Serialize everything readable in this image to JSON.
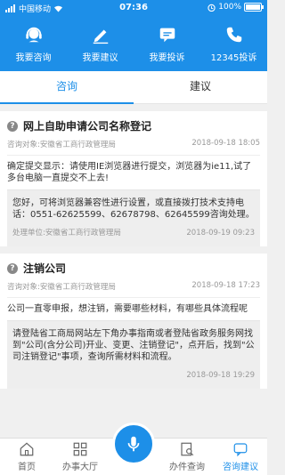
{
  "status": {
    "carrier": "中国移动",
    "time": "07:36",
    "battery": "100%"
  },
  "header": {
    "items": [
      {
        "label": "我要咨询",
        "icon": "headset-icon"
      },
      {
        "label": "我要建议",
        "icon": "pencil-note-icon"
      },
      {
        "label": "我要投诉",
        "icon": "chat-bubble-icon"
      },
      {
        "label": "12345投诉",
        "icon": "phone-icon"
      }
    ]
  },
  "tabs": [
    {
      "label": "咨询",
      "active": true
    },
    {
      "label": "建议",
      "active": false
    }
  ],
  "posts": [
    {
      "title": "网上自助申请公司名称登记",
      "target": "咨询对象:安徽省工商行政管理局",
      "date": "2018-09-18 18:05",
      "body": "确定提交显示：请使用IE浏览器进行提交，浏览器为ie11,试了多台电脑一直提交不上去!",
      "reply": "您好，可将浏览器兼容性进行设置，或直接拨打技术支持电话：0551-62625599、62678798、62645599咨询处理。",
      "reply_unit": "处理单位:安徽省工商行政管理局",
      "reply_date": "2018-09-19 09:23"
    },
    {
      "title": "注销公司",
      "target": "咨询对象:安徽省工商行政管理局",
      "date": "2018-09-18 17:23",
      "body": "公司一直零申报，想注销，需要哪些材料，有哪些具体流程呢",
      "reply": "请登陆省工商局网站左下角办事指南或者登陆省政务服务网找到\"公司(含分公司)开业、变更、注销登记\"，点开后，找到\"公司注销登记\"事项，查询所需材料和流程。",
      "reply_unit": "",
      "reply_date": "2018-09-18 19:29"
    }
  ],
  "bottom_nav": {
    "home": "首页",
    "hall": "办事大厅",
    "query": "办件查询",
    "advice": "咨询建议"
  },
  "colors": {
    "primary": "#1d8fe8"
  }
}
